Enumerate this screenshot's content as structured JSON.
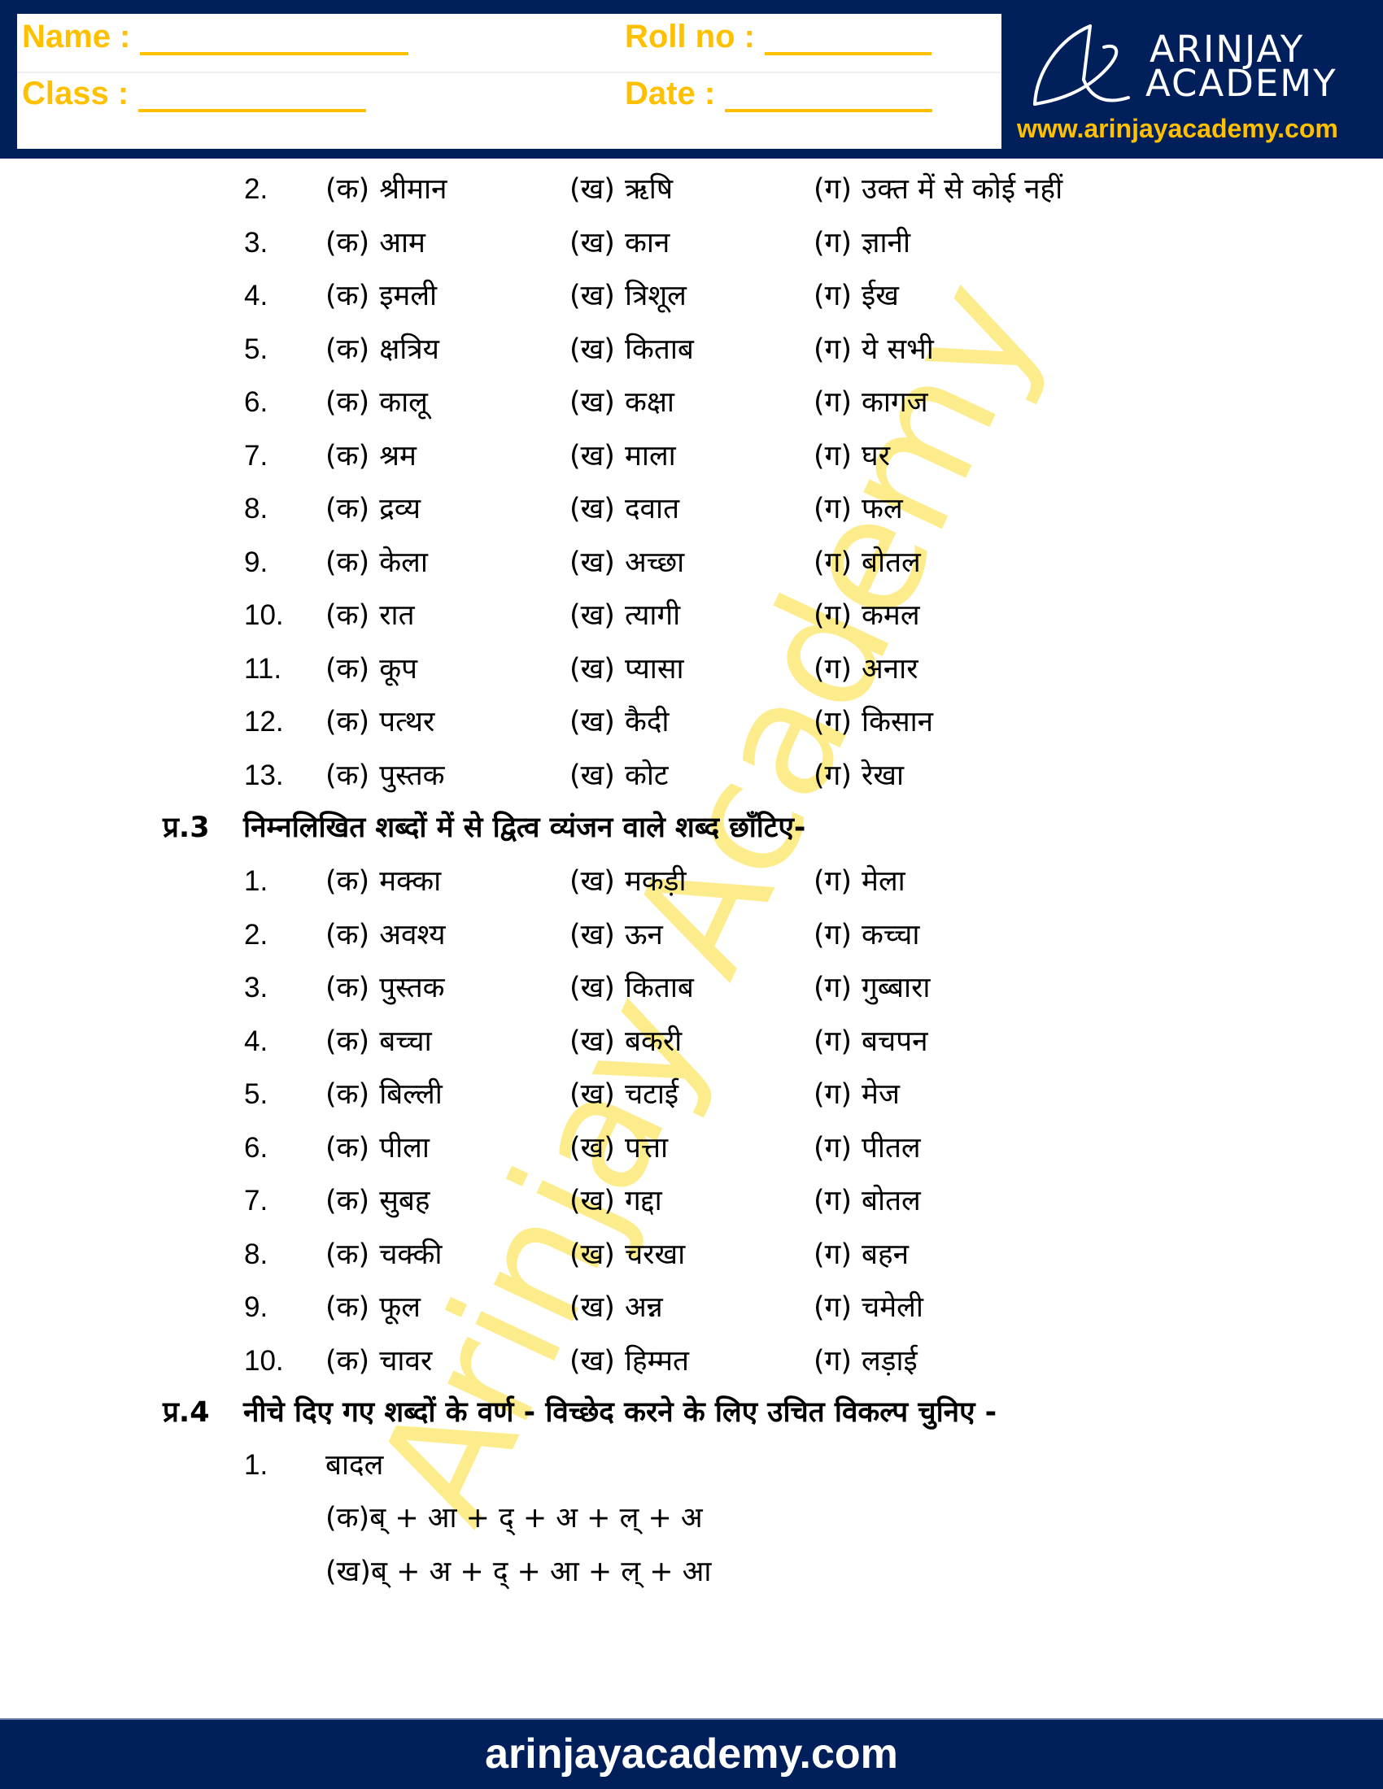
{
  "header": {
    "fields": {
      "name_label": "Name :",
      "roll_label": "Roll no :",
      "class_label": "Class :",
      "date_label": "Date :"
    },
    "logo": {
      "line1": "ARINJAY",
      "line2": "ACADEMY",
      "website": "www.arinjayacademy.com"
    }
  },
  "watermark": "Arinjay Academy",
  "q2_continued": {
    "items": [
      {
        "num": "2.",
        "a": "श्रीमान",
        "b": "ऋषि",
        "c": "उक्त में से कोई नहीं"
      },
      {
        "num": "3.",
        "a": "आम",
        "b": "कान",
        "c": "ज्ञानी"
      },
      {
        "num": "4.",
        "a": "इमली",
        "b": "त्रिशूल",
        "c": "ईख"
      },
      {
        "num": "5.",
        "a": "क्षत्रिय",
        "b": "किताब",
        "c": "ये सभी"
      },
      {
        "num": "6.",
        "a": "कालू",
        "b": "कक्षा",
        "c": "कागज"
      },
      {
        "num": "7.",
        "a": "श्रम",
        "b": "माला",
        "c": "घर"
      },
      {
        "num": "8.",
        "a": "द्रव्य",
        "b": "दवात",
        "c": "फल"
      },
      {
        "num": "9.",
        "a": "केला",
        "b": "अच्छा",
        "c": "बोतल"
      },
      {
        "num": "10.",
        "a": "रात",
        "b": "त्यागी",
        "c": "कमल"
      },
      {
        "num": "11.",
        "a": "कूप",
        "b": "प्यासा",
        "c": "अनार"
      },
      {
        "num": "12.",
        "a": "पत्थर",
        "b": "कैदी",
        "c": "किसान"
      },
      {
        "num": "13.",
        "a": "पुस्तक",
        "b": "कोट",
        "c": "रेखा"
      }
    ]
  },
  "option_labels": {
    "a": "(क)",
    "b": "(ख)",
    "c": "(ग)"
  },
  "q3": {
    "number": "प्र.3",
    "text": "निम्नलिखित शब्दों में से द्वित्व व्यंजन वाले शब्द छाँटिए-",
    "items": [
      {
        "num": "1.",
        "a": "मक्का",
        "b": "मकड़ी",
        "c": "मेला"
      },
      {
        "num": "2.",
        "a": "अवश्य",
        "b": "ऊन",
        "c": "कच्चा"
      },
      {
        "num": "3.",
        "a": "पुस्तक",
        "b": "किताब",
        "c": "गुब्बारा"
      },
      {
        "num": "4.",
        "a": "बच्चा",
        "b": "बकरी",
        "c": "बचपन"
      },
      {
        "num": "5.",
        "a": "बिल्ली",
        "b": "चटाई",
        "c": "मेज"
      },
      {
        "num": "6.",
        "a": "पीला",
        "b": "पत्ता",
        "c": "पीतल"
      },
      {
        "num": "7.",
        "a": "सुबह",
        "b": "गद्दा",
        "c": "बोतल"
      },
      {
        "num": "8.",
        "a": "चक्की",
        "b": "चरखा",
        "c": "बहन"
      },
      {
        "num": "9.",
        "a": "फूल",
        "b": "अन्न",
        "c": "चमेली"
      },
      {
        "num": "10.",
        "a": "चावर",
        "b": "हिम्मत",
        "c": "लड़ाई"
      }
    ]
  },
  "q4": {
    "number": "प्र.4",
    "text": "नीचे दिए गए शब्दों के वर्ण - विच्छेद करने के लिए उचित विकल्प चुनिए -",
    "items": [
      {
        "num": "1.",
        "word": "बादल",
        "options": [
          {
            "label": "(क)",
            "text": "ब् + आ + द् + अ + ल् + अ"
          },
          {
            "label": "(ख)",
            "text": "ब् + अ + द् + आ + ल् + आ"
          }
        ]
      }
    ]
  },
  "footer": {
    "website": "arinjayacademy.com"
  },
  "colors": {
    "navy": "#001f5b",
    "accent_yellow": "#ffc000",
    "watermark_yellow": "#fdec8c"
  }
}
